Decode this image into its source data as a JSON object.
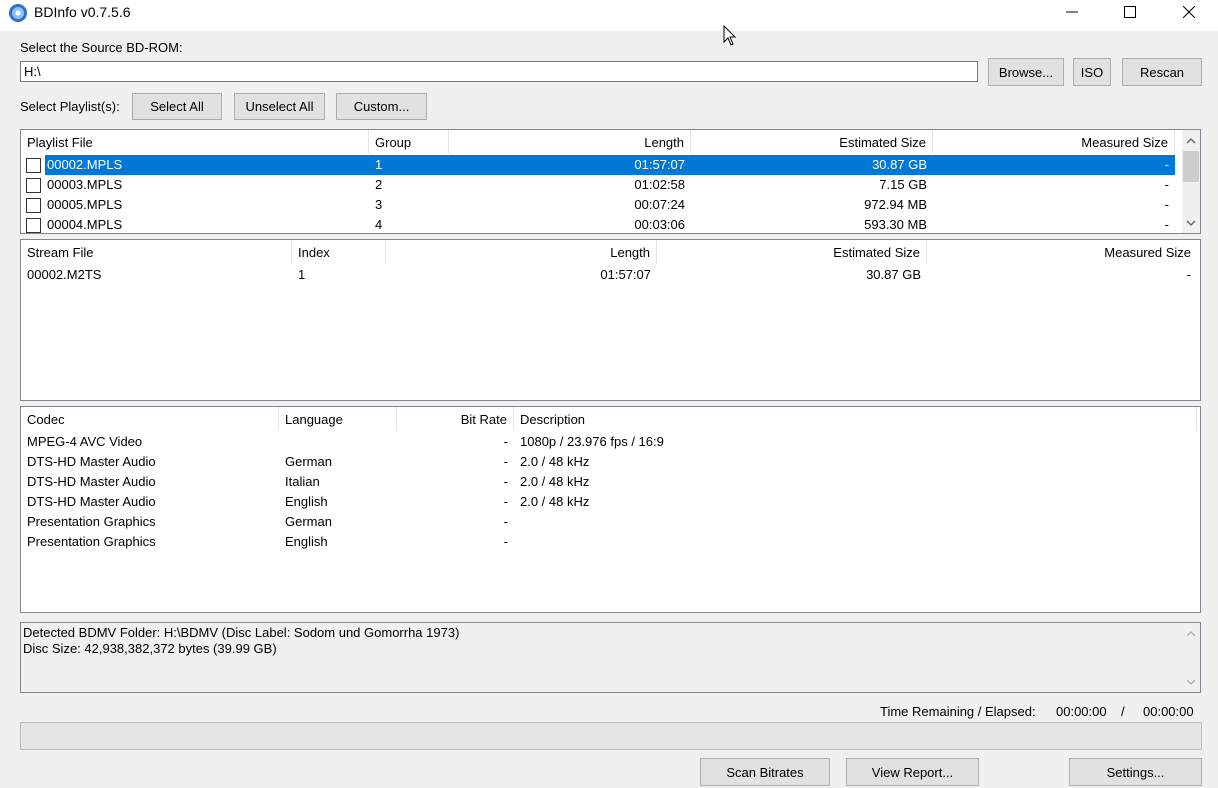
{
  "window": {
    "title": "BDInfo v0.7.5.6"
  },
  "source": {
    "label": "Select the Source BD-ROM:",
    "path": "H:\\",
    "browse": "Browse...",
    "iso": "ISO",
    "rescan": "Rescan"
  },
  "playlist_select": {
    "label": "Select Playlist(s):",
    "select_all": "Select All",
    "unselect_all": "Unselect All",
    "custom": "Custom..."
  },
  "playlists": {
    "headers": {
      "file": "Playlist File",
      "group": "Group",
      "length": "Length",
      "est": "Estimated Size",
      "meas": "Measured Size"
    },
    "rows": [
      {
        "file": "00002.MPLS",
        "group": "1",
        "length": "01:57:07",
        "est": "30.87 GB",
        "meas": "-",
        "selected": true
      },
      {
        "file": "00003.MPLS",
        "group": "2",
        "length": "01:02:58",
        "est": "7.15 GB",
        "meas": "-"
      },
      {
        "file": "00005.MPLS",
        "group": "3",
        "length": "00:07:24",
        "est": "972.94 MB",
        "meas": "-"
      },
      {
        "file": "00004.MPLS",
        "group": "4",
        "length": "00:03:06",
        "est": "593.30 MB",
        "meas": "-"
      }
    ]
  },
  "streams": {
    "headers": {
      "file": "Stream File",
      "index": "Index",
      "length": "Length",
      "est": "Estimated Size",
      "meas": "Measured Size"
    },
    "rows": [
      {
        "file": "00002.M2TS",
        "index": "1",
        "length": "01:57:07",
        "est": "30.87 GB",
        "meas": "-"
      }
    ]
  },
  "codecs": {
    "headers": {
      "codec": "Codec",
      "language": "Language",
      "bitrate": "Bit Rate",
      "description": "Description"
    },
    "rows": [
      {
        "codec": "MPEG-4 AVC Video",
        "language": "",
        "bitrate": "-",
        "description": "1080p / 23.976 fps / 16:9"
      },
      {
        "codec": "DTS-HD Master Audio",
        "language": "German",
        "bitrate": "-",
        "description": "2.0 / 48 kHz"
      },
      {
        "codec": "DTS-HD Master Audio",
        "language": "Italian",
        "bitrate": "-",
        "description": "2.0 / 48 kHz"
      },
      {
        "codec": "DTS-HD Master Audio",
        "language": "English",
        "bitrate": "-",
        "description": "2.0 / 48 kHz"
      },
      {
        "codec": "Presentation Graphics",
        "language": "German",
        "bitrate": "-",
        "description": ""
      },
      {
        "codec": "Presentation Graphics",
        "language": "English",
        "bitrate": "-",
        "description": ""
      }
    ]
  },
  "info": {
    "line1": "Detected BDMV Folder: H:\\BDMV (Disc Label: Sodom und Gomorrha 1973)",
    "line2": "Disc Size: 42,938,382,372 bytes (39.99 GB)"
  },
  "time": {
    "label": "Time Remaining / Elapsed:",
    "remaining": "00:00:00",
    "separator": "/",
    "elapsed": "00:00:00"
  },
  "progress": {
    "value": 0
  },
  "bottom": {
    "scan": "Scan Bitrates",
    "report": "View Report...",
    "settings": "Settings..."
  },
  "colors": {
    "selection": "#0078d7",
    "window_bg": "#f0f0f0"
  },
  "icons": [
    "disc-icon",
    "minimize-icon",
    "maximize-icon",
    "close-icon",
    "cursor-icon",
    "scroll-up-icon",
    "scroll-down-icon"
  ]
}
